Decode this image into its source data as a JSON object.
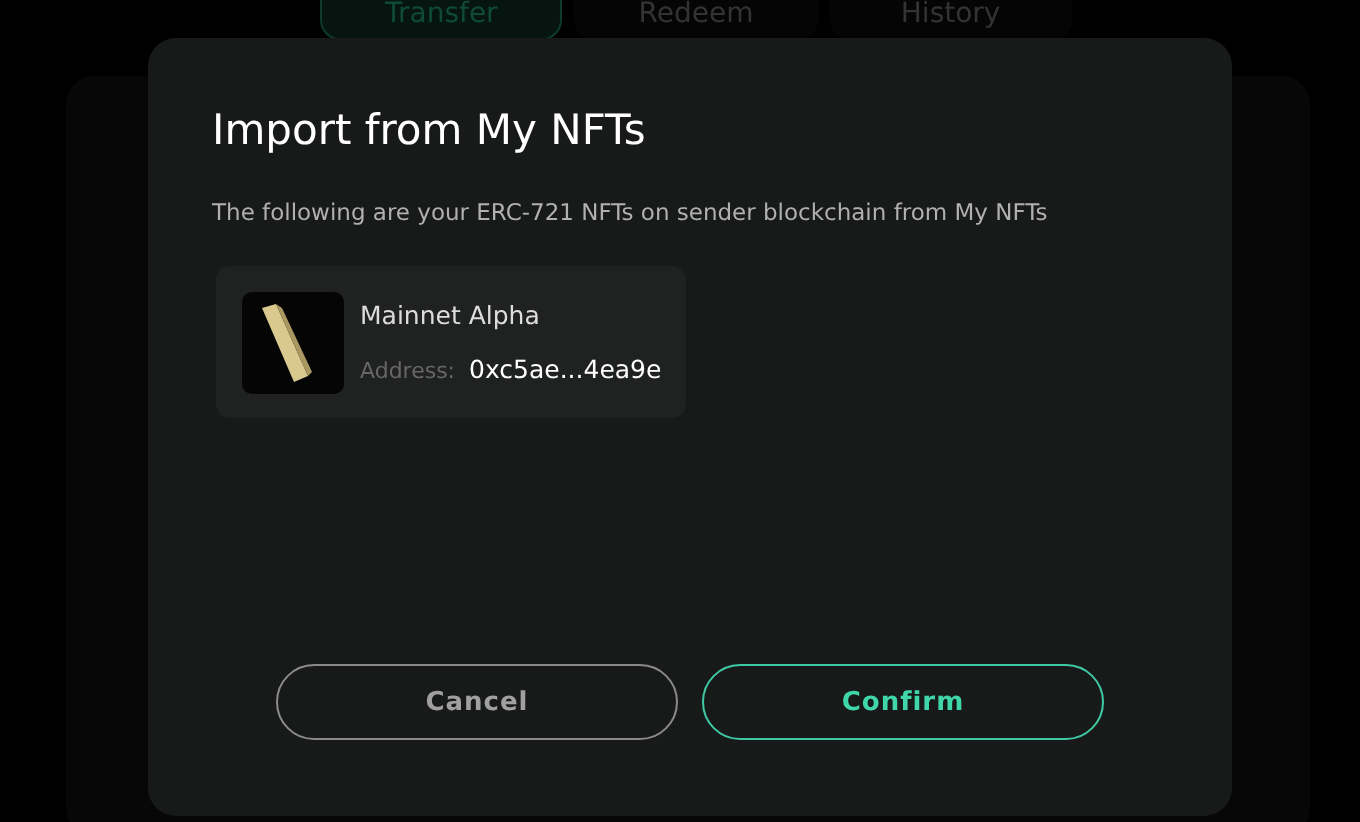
{
  "tabs": [
    {
      "label": "Transfer",
      "selected": true
    },
    {
      "label": "Redeem",
      "selected": false
    },
    {
      "label": "History",
      "selected": false
    }
  ],
  "dialog": {
    "title": "Import from My NFTs",
    "description": "The following are your ERC-721 NFTs on sender blockchain from My NFTs",
    "nfts": [
      {
        "name": "Mainnet Alpha",
        "address_label": "Address:",
        "address": "0xc5ae...4ea9e"
      }
    ],
    "buttons": [
      {
        "label": "Cancel",
        "kind": "secondary"
      },
      {
        "label": "Confirm",
        "kind": "primary"
      }
    ]
  }
}
